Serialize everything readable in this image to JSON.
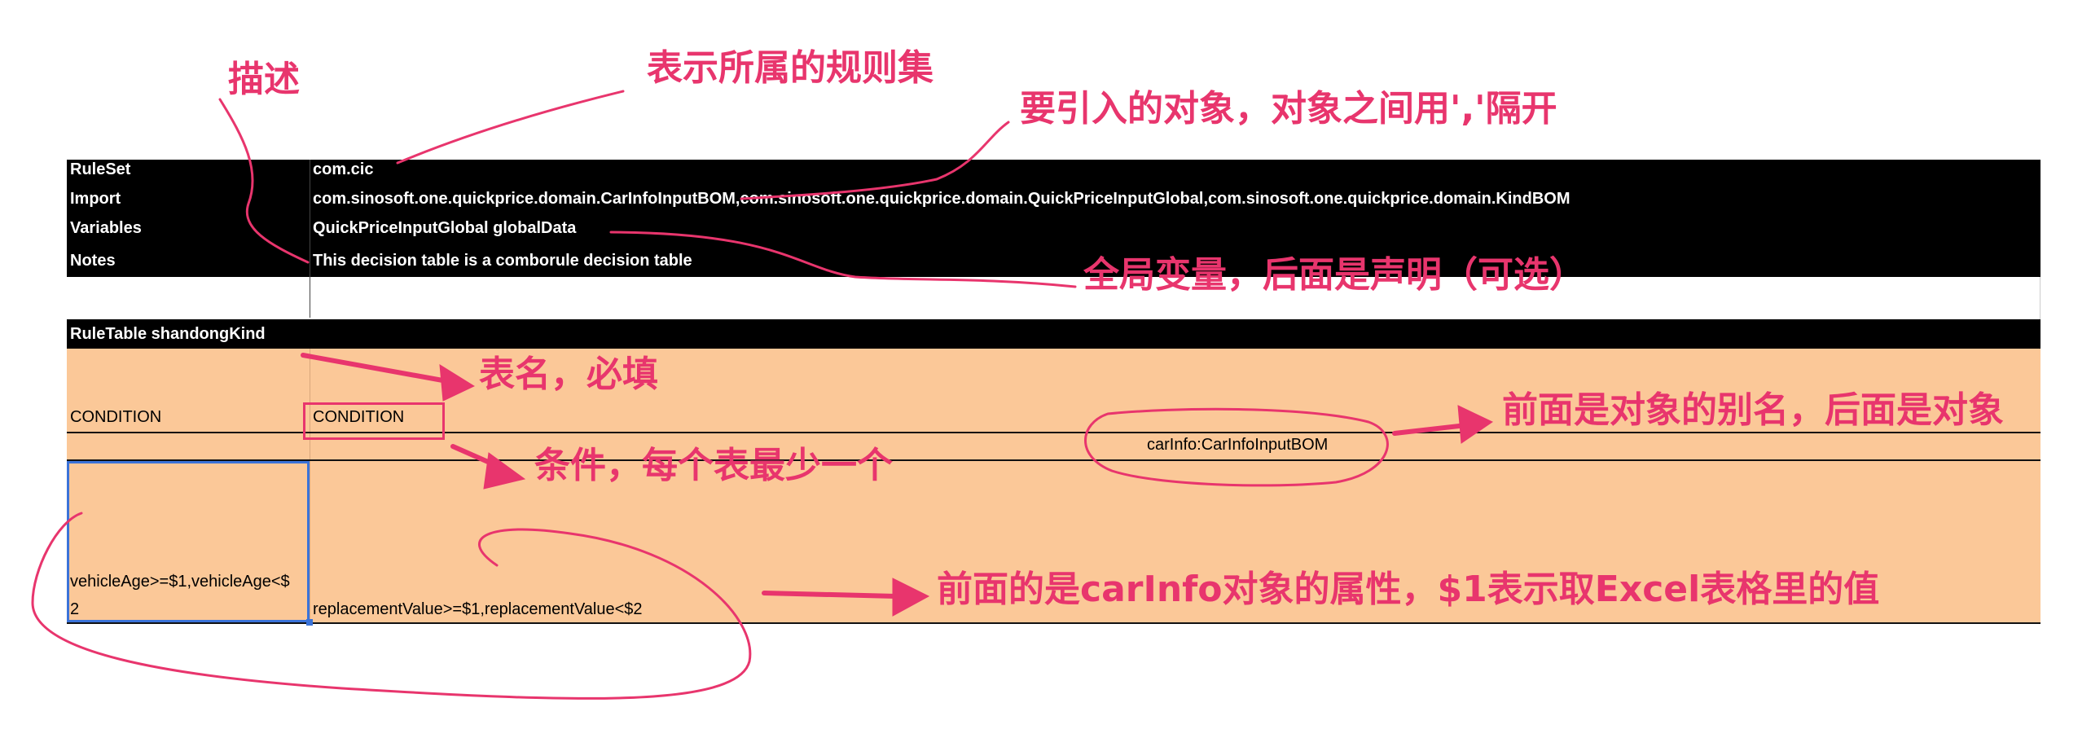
{
  "header_rows": {
    "ruleset": {
      "label": "RuleSet",
      "value": "com.cic"
    },
    "import": {
      "label": "Import",
      "value": "com.sinosoft.one.quickprice.domain.CarInfoInputBOM,com.sinosoft.one.quickprice.domain.QuickPriceInputGlobal,com.sinosoft.one.quickprice.domain.KindBOM"
    },
    "variables": {
      "label": "Variables",
      "value": "QuickPriceInputGlobal globalData"
    },
    "notes": {
      "label": "Notes",
      "value": "This decision table is a comborule decision table"
    }
  },
  "rule_table": {
    "title": "RuleTable shandongKind",
    "condition_col1": "CONDITION",
    "condition_col2": "CONDITION",
    "object_binding": "carInfo:CarInfoInputBOM",
    "expr_col1_line1": "vehicleAge>=$1,vehicleAge<$",
    "expr_col1_line2": "2",
    "expr_col2": "replacementValue>=$1,replacementValue<$2"
  },
  "annotations": {
    "describe": "描述",
    "ruleset_note": "表示所属的规则集",
    "import_note": "要引入的对象，对象之间用','隔开",
    "variables_note": "全局变量，后面是声明（可选）",
    "table_name_note": "表名，必填",
    "condition_note": "条件，每个表最少一个",
    "alias_note": "前面是对象的别名，后面是对象",
    "property_note": "前面的是carInfo对象的属性，$1表示取Excel表格里的值"
  },
  "colors": {
    "annotation": "#e8356d",
    "header_band": "#000000",
    "table_fill": "#fbc898",
    "selection": "#3b73d8"
  }
}
